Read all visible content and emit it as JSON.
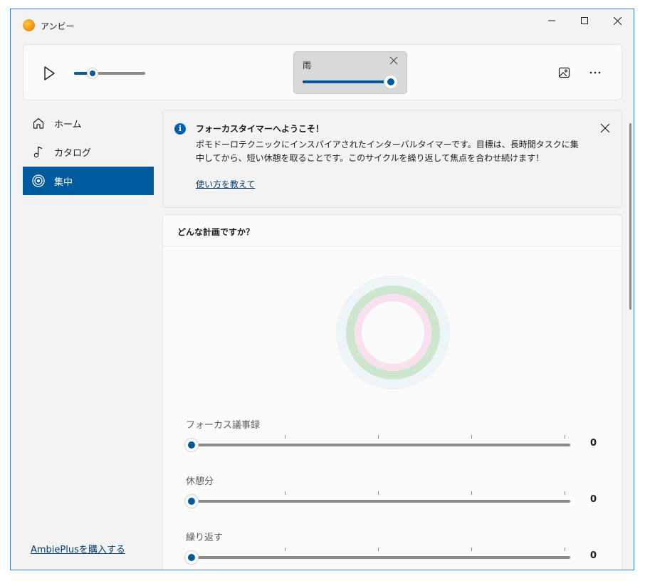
{
  "window": {
    "title": "アンビー"
  },
  "player": {
    "volume_percent": 26,
    "sound": {
      "name": "雨",
      "volume_percent": 100
    }
  },
  "sidebar": {
    "items": [
      {
        "label": "ホーム",
        "icon": "home-icon",
        "active": false
      },
      {
        "label": "カタログ",
        "icon": "music-note-icon",
        "active": false
      },
      {
        "label": "集中",
        "icon": "target-icon",
        "active": true
      }
    ],
    "buy_link": "AmbiePlusを購入する"
  },
  "infobar": {
    "title": "フォーカスタイマーへようこそ！",
    "body": "ポモドーロテクニックにインスパイアされたインターバルタイマーです。目標は、長時間タスクに集中してから、短い休憩を取ることです。このサイクルを繰り返して焦点を合わせ続けます！",
    "link": "使い方を教えて"
  },
  "focus": {
    "title": "どんな計画ですか？",
    "sliders": [
      {
        "label": "フォーカス議事録",
        "value": "0"
      },
      {
        "label": "休憩分",
        "value": "0"
      },
      {
        "label": "繰り返す",
        "value": "0"
      }
    ]
  },
  "colors": {
    "accent": "#005a9e",
    "ring_outer": "#eef5f8",
    "ring_green": "#cde6cd",
    "ring_pink": "#f9e0ee"
  }
}
